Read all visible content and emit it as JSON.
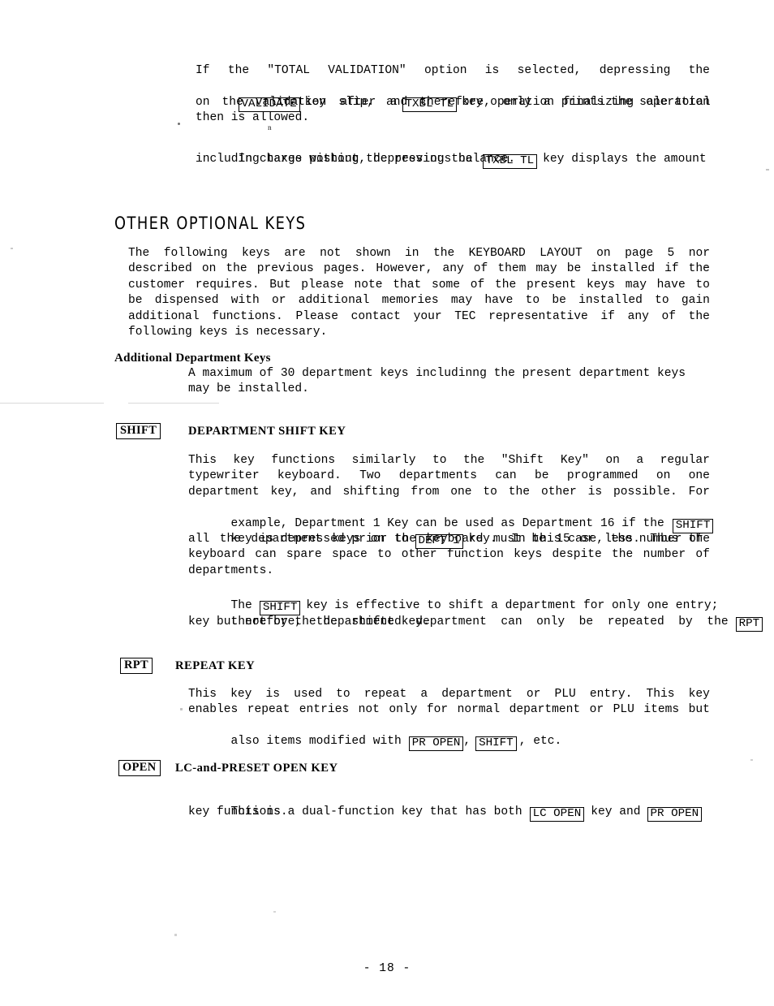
{
  "document": {
    "page_number_label": "- 18 -"
  },
  "intro": {
    "paragraph1": {
      "lines": [
        [
          "If",
          "the",
          "\"TOTAL",
          "VALIDATION\"",
          "option",
          "is",
          "selected,",
          "depressing",
          "the"
        ],
        null,
        [
          "on",
          "the",
          "validation",
          "slip,",
          "and",
          "therefore,",
          "only",
          "a",
          "finalizing",
          "operation"
        ],
        [
          "then is allowed."
        ]
      ],
      "line2_pre": "",
      "line2_key1": "VALIDATE",
      "line2_mid": "key  after  a",
      "line2_key2": "TXBL TL",
      "line2_post": "key operation prints the sale total"
    },
    "paragraph2": {
      "line1_pre": "In charge posting, depressing the",
      "line1_key": "TXBL TL",
      "line1_post": "key displays the amount",
      "line2": "including taxes without the previous balance."
    }
  },
  "section": {
    "title": "OTHER OPTIONAL KEYS",
    "intro_lines": [
      [
        "The",
        "following",
        "keys",
        "are",
        "not",
        "shown",
        "in",
        "the",
        "KEYBOARD",
        "LAYOUT",
        "on",
        "page",
        "5",
        "nor"
      ],
      [
        "described",
        "on",
        "the",
        "previous",
        "pages.",
        "However,",
        "any",
        "of",
        "them",
        "may",
        "be",
        "installed",
        "if",
        "the"
      ],
      [
        "customer",
        "requires.",
        "",
        "But",
        "please",
        "note",
        "that",
        "some",
        "of",
        "the",
        "present",
        "keys",
        "may",
        "have",
        "to"
      ],
      [
        "be",
        "dispensed",
        "with",
        "or",
        "additional",
        "memories",
        "may",
        "have",
        "to",
        "be",
        "installed",
        "to",
        "gain"
      ],
      [
        "additional",
        "functions.",
        "",
        "Please",
        "contact",
        "your",
        "TEC",
        "representative",
        "if",
        "any",
        "of",
        "the"
      ],
      [
        "following keys is necessary."
      ]
    ]
  },
  "additional_departments": {
    "heading": "Additional Department Keys",
    "lines": [
      "A maximum of 30 department keys includinng the present department keys",
      "may be installed."
    ]
  },
  "shift_key": {
    "margin_key_label": "SHIFT",
    "title": "DEPARTMENT SHIFT KEY",
    "paragraph1": {
      "lines": [
        [
          "This",
          "key",
          "functions",
          "similarly",
          "to",
          "the",
          "\"Shift",
          "Key\"",
          "on",
          "a",
          "regular"
        ],
        [
          "typewriter",
          "keyboard.",
          "",
          "Two",
          "departments",
          "can",
          "be",
          "programmed",
          "on",
          "one"
        ],
        [
          "department",
          "key,",
          "and",
          "shifting",
          "from",
          "one",
          "to",
          "the",
          "other",
          "is",
          "possible.",
          "",
          "For"
        ],
        null,
        null,
        [
          "all",
          "the",
          "department",
          "keys",
          "on",
          "the",
          "keyboard",
          "must",
          "be",
          "15",
          "or",
          "less.",
          "",
          "Thus",
          "the"
        ],
        [
          "keyboard",
          "can",
          "spare",
          "space",
          "to",
          "other",
          "function",
          "keys",
          "despite",
          "the",
          "number",
          "of"
        ],
        [
          "departments."
        ]
      ],
      "line4_pre": "example, Department 1 Key can be used as Department 16 if the",
      "line4_key": "SHIFT",
      "line5_pre": "key is depressed prior to",
      "line5_key": "DEPT 1",
      "line5_post": "key.  In this case, the number of"
    },
    "paragraph2": {
      "line1_pre": "The",
      "line1_key": "SHIFT",
      "line1_post": "key is effective to shift a department for only one entry;",
      "line2_pre": "therefore,  the  shifted  department  can  only  be  repeated  by  the",
      "line2_key": "RPT",
      "line3": "key but not by the department key."
    }
  },
  "repeat_key": {
    "margin_key_label": "RPT",
    "title": "REPEAT KEY",
    "paragraph": {
      "line1": [
        "This",
        "key",
        "is",
        "used",
        "to",
        "repeat",
        "a",
        "department",
        "or",
        "PLU",
        "entry.",
        "",
        "This",
        "key"
      ],
      "line2": [
        "enables",
        "repeat",
        "entries",
        "not",
        "only",
        "for",
        "normal",
        "department",
        "or",
        "PLU",
        "items",
        "but"
      ],
      "line3_pre": "also items modified with",
      "line3_key1": "PR OPEN",
      "line3_mid": ",",
      "line3_key2": "SHIFT",
      "line3_post": ", etc."
    }
  },
  "open_key": {
    "margin_key_label": "OPEN",
    "title": "LC-and-PRESET OPEN KEY",
    "paragraph": {
      "line1_pre": "This is a dual-function key that has both",
      "line1_key1": "LC OPEN",
      "line1_mid": "key and",
      "line1_key2": "PR OPEN",
      "line2": "key functions."
    }
  }
}
